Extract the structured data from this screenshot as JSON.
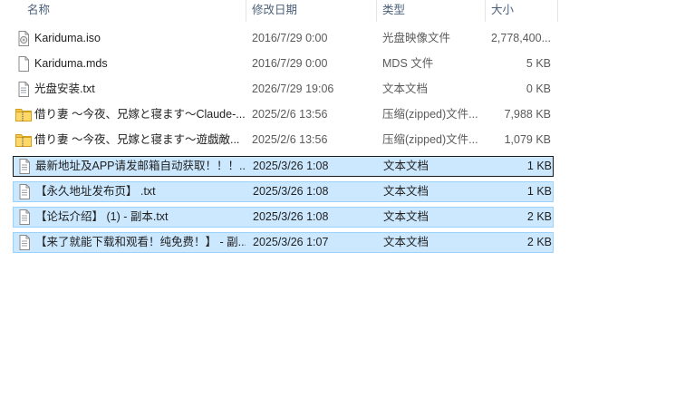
{
  "columns": {
    "name": "名称",
    "date": "修改日期",
    "type": "类型",
    "size": "大小"
  },
  "sort_indicator": "^",
  "files": [
    {
      "name": "Kariduma.iso",
      "date": "2016/7/29 0:00",
      "type": "光盘映像文件",
      "size": "2,778,400...",
      "icon": "disc-image-icon",
      "selected": false
    },
    {
      "name": "Kariduma.mds",
      "date": "2016/7/29 0:00",
      "type": "MDS 文件",
      "size": "5 KB",
      "icon": "file-icon",
      "selected": false
    },
    {
      "name": "光盘安装.txt",
      "date": "2026/7/29 19:06",
      "type": "文本文档",
      "size": "0 KB",
      "icon": "text-file-icon",
      "selected": false
    },
    {
      "name": "借り妻 ～今夜、兄嫁と寝ます～Claude-...",
      "date": "2025/2/6 13:56",
      "type": "压缩(zipped)文件...",
      "size": "7,988 KB",
      "icon": "zip-folder-icon",
      "selected": false
    },
    {
      "name": "借り妻 ～今夜、兄嫁と寝ます～遊戯敵...",
      "date": "2025/2/6 13:56",
      "type": "压缩(zipped)文件...",
      "size": "1,079 KB",
      "icon": "zip-folder-icon",
      "selected": false
    },
    {
      "name": "最新地址及APP请发邮箱自动获取！！！...",
      "date": "2025/3/26 1:08",
      "type": "文本文档",
      "size": "1 KB",
      "icon": "text-file-icon",
      "selected": true,
      "focused": true
    },
    {
      "name": "【永久地址发布页】 .txt",
      "date": "2025/3/26 1:08",
      "type": "文本文档",
      "size": "1 KB",
      "icon": "text-file-icon",
      "selected": true
    },
    {
      "name": "【论坛介绍】 (1) - 副本.txt",
      "date": "2025/3/26 1:08",
      "type": "文本文档",
      "size": "2 KB",
      "icon": "text-file-icon",
      "selected": true
    },
    {
      "name": "【来了就能下载和观看！纯免费！】 - 副...",
      "date": "2025/3/26 1:07",
      "type": "文本文档",
      "size": "2 KB",
      "icon": "text-file-icon",
      "selected": true
    }
  ],
  "colors": {
    "selection_bg": "#cce8ff",
    "selection_border": "#99d1ff",
    "focus_border": "#1a1a1a",
    "header_text": "#4c607a",
    "folder": "#f5c451"
  }
}
